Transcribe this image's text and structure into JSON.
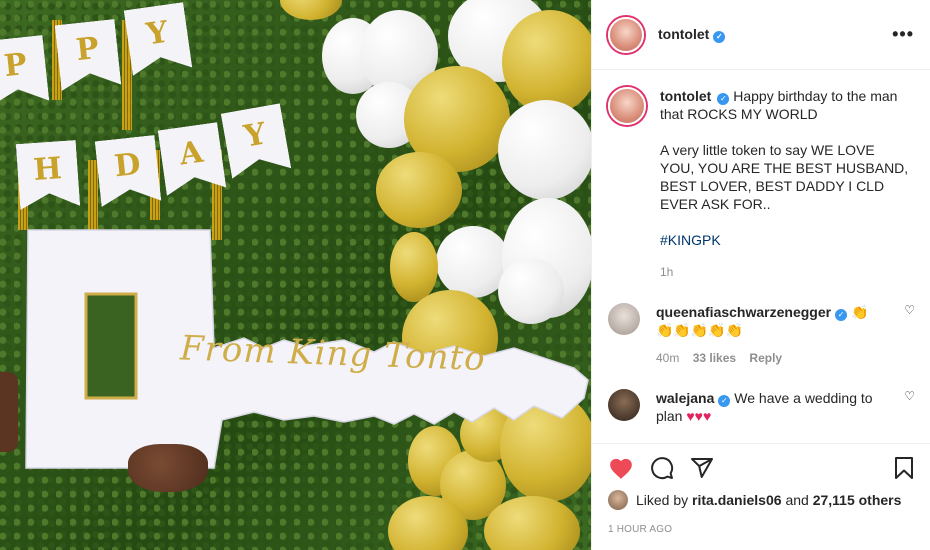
{
  "photo": {
    "bunting_letters": [
      "P",
      "P",
      "Y",
      "H",
      "D",
      "A",
      "Y"
    ],
    "key_text": "From King Tonto"
  },
  "post": {
    "author": "tontolet",
    "more_icon": "more-options-icon",
    "caption": {
      "author": "tontolet",
      "line1": "Happy birthday to the man that ROCKS MY WORLD",
      "line2": "A very little token to say WE LOVE YOU, YOU ARE THE BEST HUSBAND, BEST LOVER, BEST DADDY I CLD EVER ASK FOR..",
      "hashtag": "#KINGPK",
      "time": "1h"
    },
    "comments": [
      {
        "author": "queenafiaschwarzenegger",
        "text": "👏",
        "text2": "👏👏👏👏👏",
        "time": "40m",
        "likes": "33 likes",
        "reply": "Reply"
      },
      {
        "author": "walejana",
        "text": "We have a wedding to plan",
        "hearts": "♥♥♥"
      }
    ],
    "actions": {
      "liked_by_prefix": "Liked by",
      "liked_by_user": "rita.daniels06",
      "liked_by_and": "and",
      "liked_by_count": "27,115 others",
      "posted_ago": "1 HOUR AGO"
    }
  },
  "colors": {
    "like_red": "#ed4956",
    "verified_blue": "#3897f0",
    "hashtag_blue": "#00376b"
  }
}
